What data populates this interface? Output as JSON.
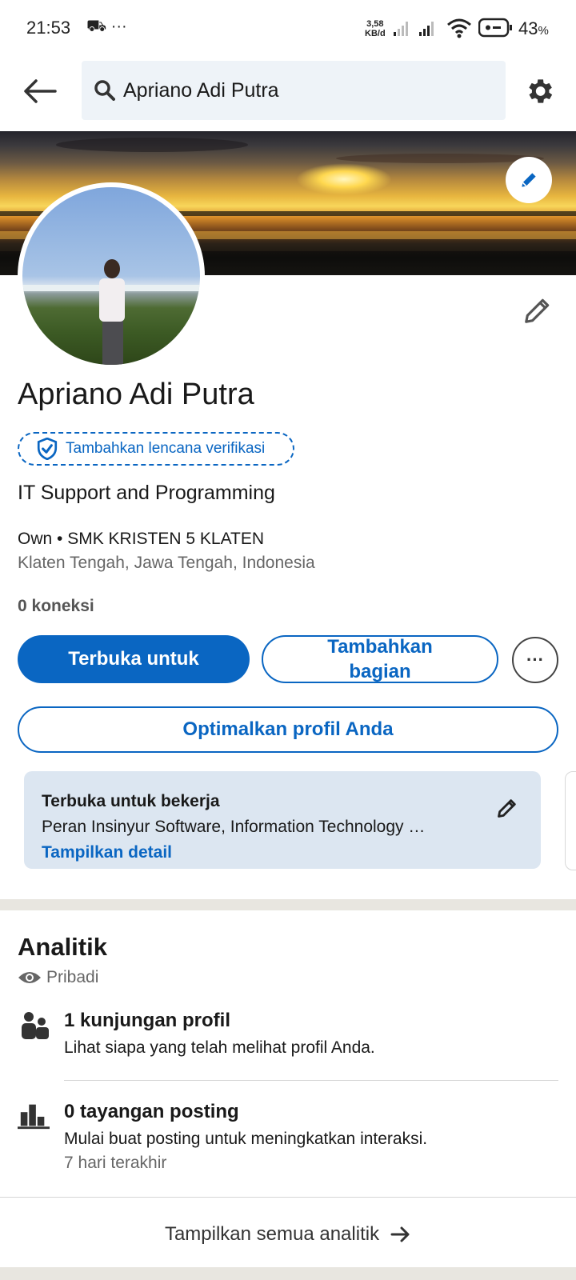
{
  "status_bar": {
    "time": "21:53",
    "left_icons": "⛟ ···",
    "net_speed_value": "3,58",
    "net_speed_unit": "KB/d",
    "battery_pct": "43",
    "battery_unit": "%"
  },
  "header": {
    "search_value": "Apriano Adi Putra"
  },
  "profile": {
    "name": "Apriano Adi Putra",
    "verify_badge": "Tambahkan lencana verifikasi",
    "headline": "IT Support and Programming",
    "company": "Own • SMK KRISTEN 5 KLATEN",
    "location": "Klaten Tengah, Jawa Tengah, Indonesia",
    "connections": "0 koneksi"
  },
  "actions": {
    "open_to": "Terbuka untuk",
    "add_section_line1": "Tambahkan",
    "add_section_line2": "bagian",
    "more": "···",
    "optimize": "Optimalkan profil Anda"
  },
  "open_to_work": {
    "title": "Terbuka untuk bekerja",
    "roles": "Peran Insinyur Software, Information Technology …",
    "details_link": "Tampilkan detail"
  },
  "analytics": {
    "title": "Analitik",
    "visibility": "Pribadi",
    "items": [
      {
        "headline": "1 kunjungan profil",
        "sub": "Lihat siapa yang telah melihat profil Anda."
      },
      {
        "headline": "0 tayangan posting",
        "sub": "Mulai buat posting untuk meningkatkan interaksi.",
        "note": "7 hari terakhir"
      }
    ],
    "show_all": "Tampilkan semua analitik"
  },
  "colors": {
    "accent": "#0a66c2",
    "card_bg": "#dce6f1",
    "search_bg": "#eef3f8"
  }
}
